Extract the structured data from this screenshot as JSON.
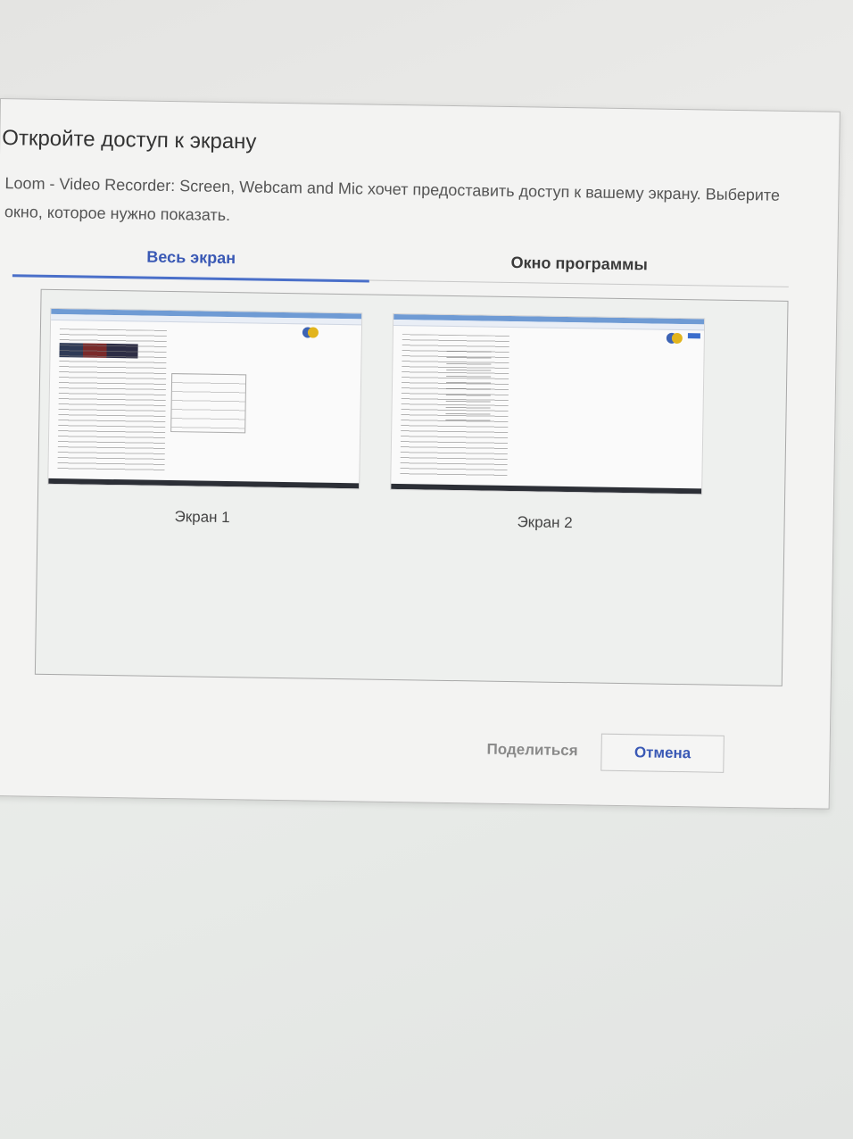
{
  "dialog": {
    "title": "Откройте доступ к экрану",
    "description": "Loom - Video Recorder: Screen, Webcam and Mic хочет предоставить доступ к вашему экрану. Выберите окно, которое нужно показать."
  },
  "tabs": [
    {
      "label": "Весь экран",
      "selected": true
    },
    {
      "label": "Окно программы",
      "selected": false
    }
  ],
  "screens": [
    {
      "label": "Экран 1"
    },
    {
      "label": "Экран 2"
    }
  ],
  "buttons": {
    "share": "Поделиться",
    "cancel": "Отмена"
  },
  "colors": {
    "accent": "#3a59b5",
    "tab_underline": "#4a6fc9",
    "disabled_text": "#8a8a8a"
  }
}
